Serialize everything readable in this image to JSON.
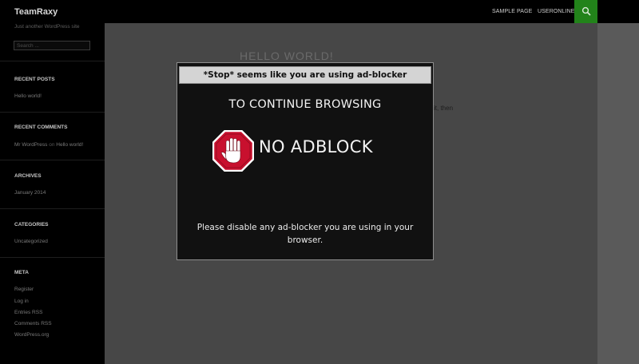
{
  "header": {
    "site_title": "TeamRaxy",
    "nav": [
      "SAMPLE PAGE",
      "USERONLINE"
    ],
    "search_icon": "search-icon",
    "accent_color": "#22831a"
  },
  "sidebar": {
    "tagline": "Just another WordPress site",
    "search_placeholder": "Search ...",
    "recent_posts": {
      "heading": "RECENT POSTS",
      "items": [
        "Hello world!"
      ]
    },
    "recent_comments": {
      "heading": "RECENT COMMENTS",
      "author": "Mr WordPress",
      "on": " on ",
      "post": "Hello world!"
    },
    "archives": {
      "heading": "ARCHIVES",
      "items": [
        "January 2014"
      ]
    },
    "categories": {
      "heading": "CATEGORIES",
      "items": [
        "Uncategorized"
      ]
    },
    "meta": {
      "heading": "META",
      "items": [
        "Register",
        "Log in",
        "Entries RSS",
        "Comments RSS",
        "WordPress.org"
      ]
    }
  },
  "main": {
    "title_fragment": "HELLO WORLD!",
    "text_fragment": "it, then"
  },
  "modal": {
    "title": "*Stop* seems like you are using ad-blocker",
    "headline": "TO CONTINUE BROWSING",
    "badge_text": "NO ADBLOCK",
    "badge_icon": "stop-hand-icon",
    "message": "Please disable any ad-blocker you are using in your browser."
  }
}
